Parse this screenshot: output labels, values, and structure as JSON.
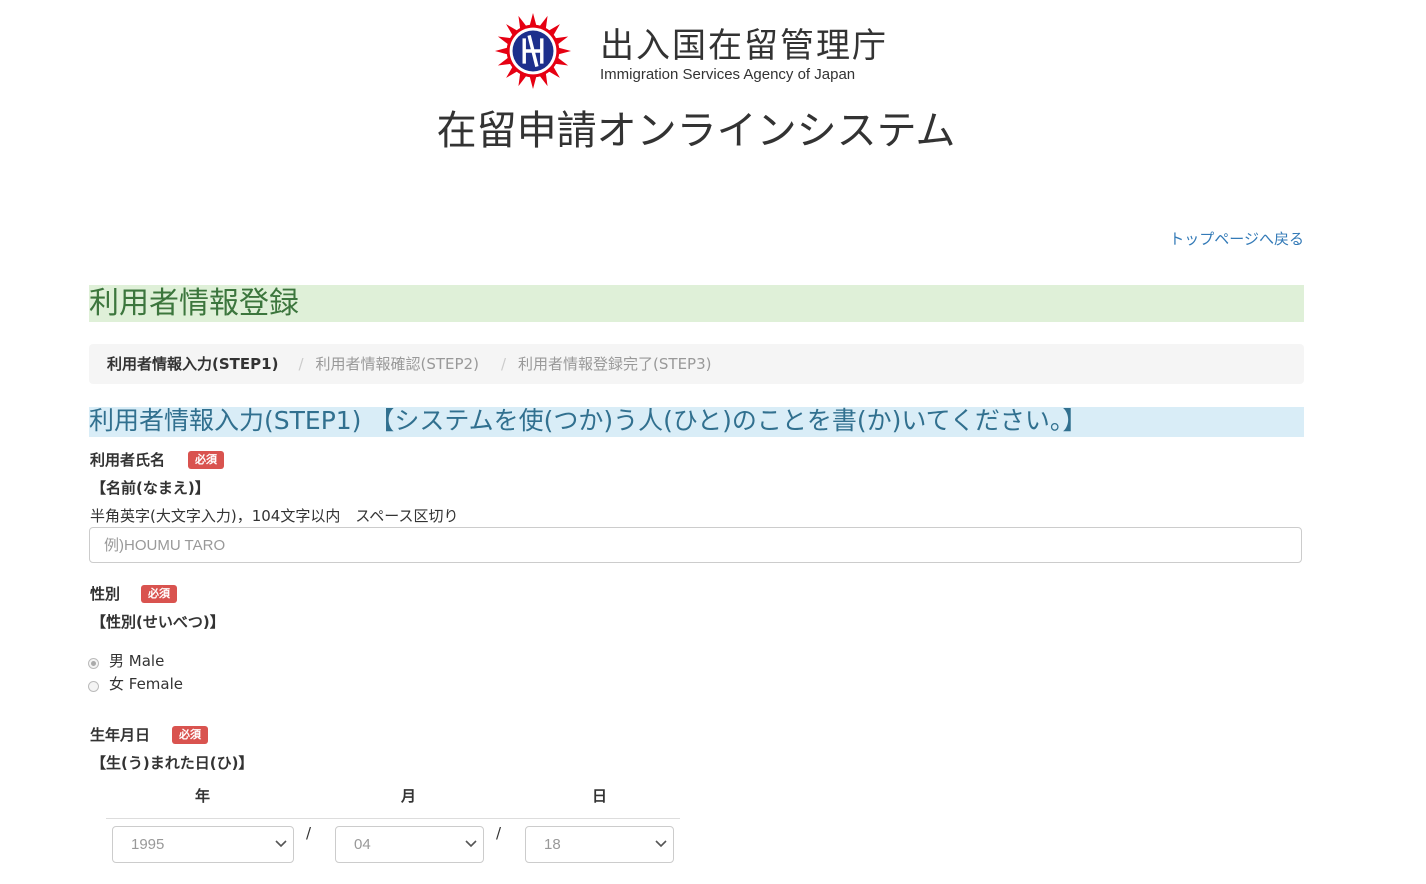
{
  "header": {
    "agency_jp": "出入国在留管理庁",
    "agency_en": "Immigration Services Agency of Japan",
    "system_title": "在留申請オンラインシステム"
  },
  "nav": {
    "back_link": "トップページへ戻る"
  },
  "page": {
    "heading": "利用者情報登録",
    "breadcrumb": [
      "利用者情報入力(STEP1)",
      "利用者情報確認(STEP2)",
      "利用者情報登録完了(STEP3)"
    ],
    "step_heading": "利用者情報入力(STEP1) 【システムを使(つか)う人(ひと)のことを書(か)いてください。】"
  },
  "form": {
    "required_badge": "必須",
    "name": {
      "label": "利用者氏名",
      "sub_label": "【名前(なまえ)】",
      "hint": "半角英字(大文字入力)，104文字以内　スペース区切り",
      "placeholder": "例)HOUMU TARO",
      "value": ""
    },
    "gender": {
      "label": "性別",
      "sub_label": "【性別(せいべつ)】",
      "options": [
        "男 Male",
        "女 Female"
      ],
      "selected": "男 Male"
    },
    "birthdate": {
      "label": "生年月日",
      "sub_label": "【生(う)まれた日(ひ)】",
      "col_year": "年",
      "col_month": "月",
      "col_day": "日",
      "separator": "/",
      "year": "1995",
      "month": "04",
      "day": "18"
    }
  },
  "colors": {
    "link": "#337ab7",
    "heading_bg": "#dff0d8",
    "heading_text": "#3c763d",
    "step_bg": "#d9edf7",
    "step_text": "#31708f",
    "badge_bg": "#d9534f",
    "seal_red": "#e60012",
    "seal_blue": "#1d2f8c"
  }
}
